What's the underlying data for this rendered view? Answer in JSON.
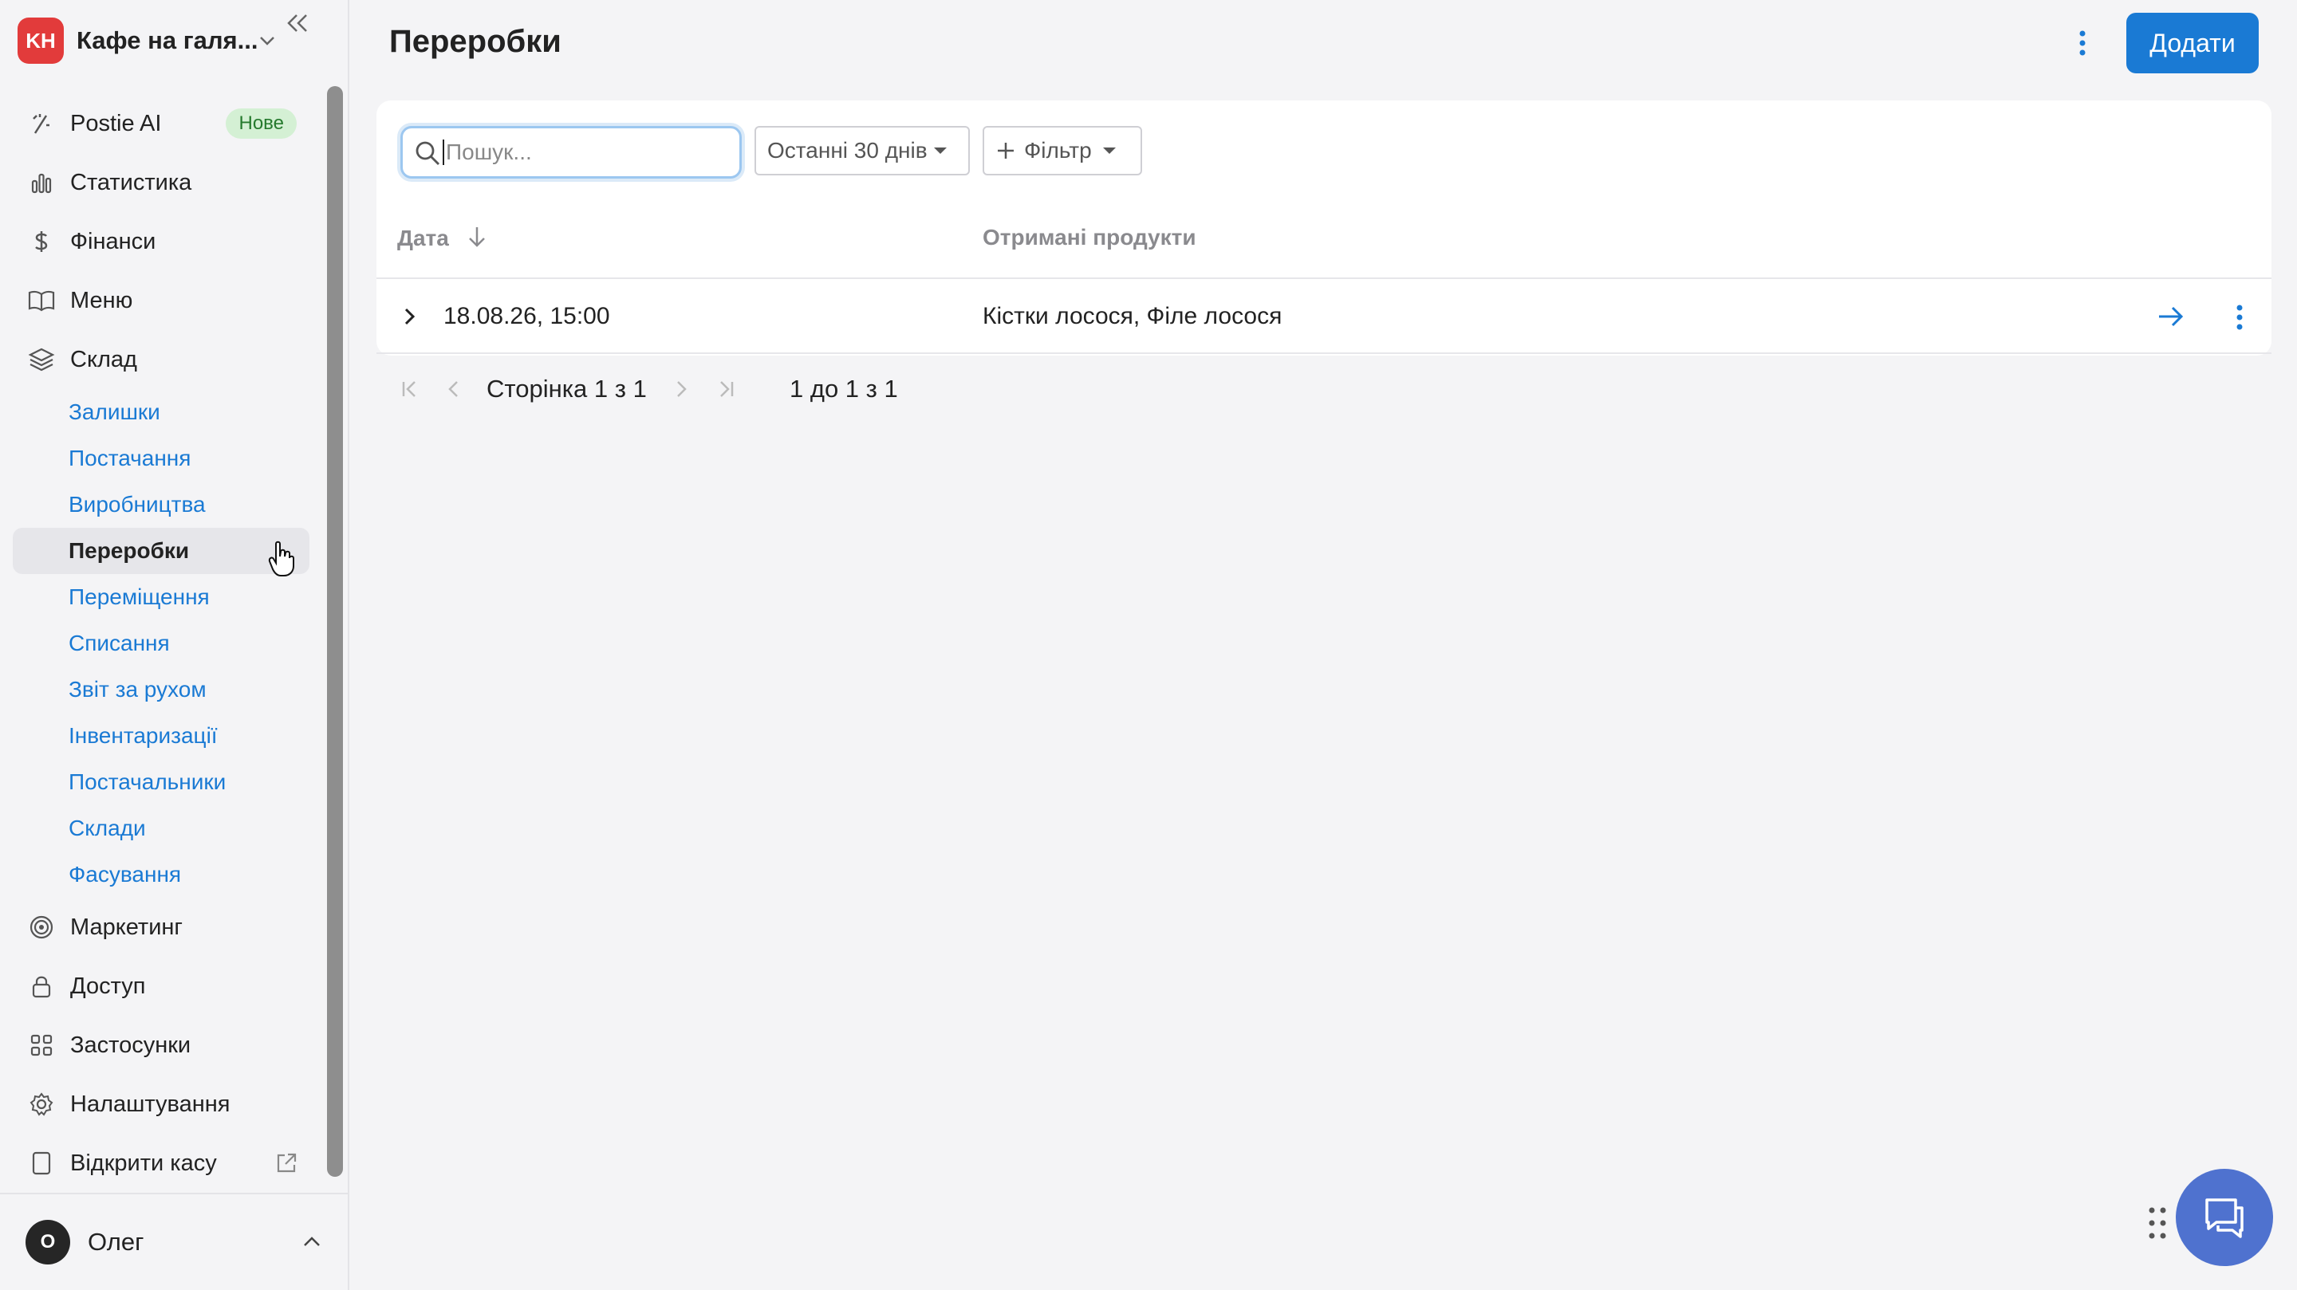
{
  "org": {
    "initials": "KH",
    "name": "Кафе на галя..."
  },
  "nav": {
    "postie": {
      "label": "Postie AI",
      "badge": "Нове"
    },
    "stats": "Статистика",
    "finance": "Фінанси",
    "menu": "Меню",
    "warehouse": "Склад",
    "warehouse_sub": [
      "Залишки",
      "Постачання",
      "Виробництва",
      "Переробки",
      "Переміщення",
      "Списання",
      "Звіт за рухом",
      "Інвентаризації",
      "Постачальники",
      "Склади",
      "Фасування"
    ],
    "marketing": "Маркетинг",
    "access": "Доступ",
    "apps": "Застосунки",
    "settings": "Налаштування",
    "open_register": "Відкрити касу"
  },
  "user": {
    "initial": "О",
    "name": "Олег"
  },
  "page": {
    "title": "Переробки",
    "add_label": "Додати"
  },
  "filters": {
    "search_placeholder": "Пошук...",
    "period": "Останні 30 днів",
    "filter_label": "Фільтр"
  },
  "table": {
    "headers": {
      "date": "Дата",
      "products": "Отримані продукти"
    },
    "rows": [
      {
        "date": "18.08.26, 15:00",
        "products": "Кістки лосося, Філе лосося"
      }
    ]
  },
  "pagination": {
    "page_label": "Сторінка",
    "current": "1",
    "of": "з",
    "total": "1",
    "range_text": "1 до 1 з 1"
  },
  "colors": {
    "accent": "#1a7ad4",
    "brand": "#e23b3b",
    "chat": "#4f72cf"
  }
}
